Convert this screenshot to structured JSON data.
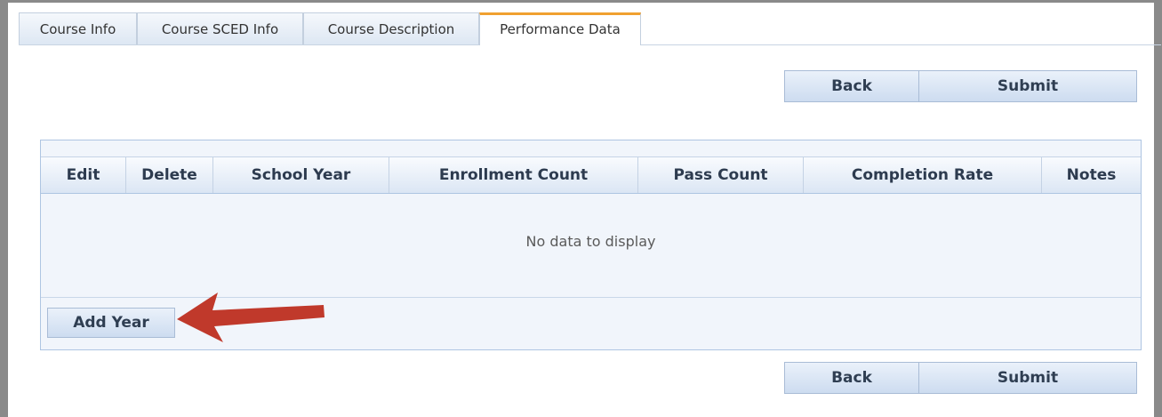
{
  "tabs": [
    {
      "label": "Course Info"
    },
    {
      "label": "Course SCED Info"
    },
    {
      "label": "Course Description"
    },
    {
      "label": "Performance Data"
    }
  ],
  "active_tab": "Performance Data",
  "toolbar_top": {
    "back": "Back",
    "submit": "Submit"
  },
  "grid": {
    "columns": [
      "Edit",
      "Delete",
      "School Year",
      "Enrollment Count",
      "Pass Count",
      "Completion Rate",
      "Notes"
    ],
    "empty_message": "No data to display",
    "add_button": "Add Year"
  },
  "toolbar_bottom": {
    "back": "Back",
    "submit": "Submit"
  },
  "colors": {
    "accent_tab": "#f0a030",
    "arrow": "#c0392b"
  },
  "icons": [
    "arrow-left-annotation-icon"
  ]
}
